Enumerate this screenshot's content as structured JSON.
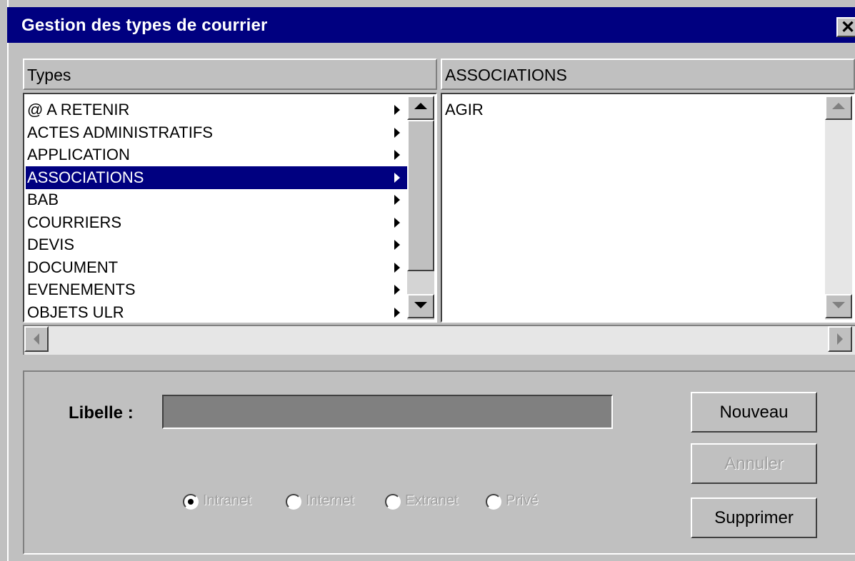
{
  "window": {
    "title": "Gestion des types de courrier",
    "close_glyph": "✕"
  },
  "types": {
    "header": "Types",
    "items": [
      {
        "label": "@ A RETENIR",
        "selected": false
      },
      {
        "label": "ACTES ADMINISTRATIFS",
        "selected": false
      },
      {
        "label": "APPLICATION",
        "selected": false
      },
      {
        "label": "ASSOCIATIONS",
        "selected": true
      },
      {
        "label": "BAB",
        "selected": false
      },
      {
        "label": "COURRIERS",
        "selected": false
      },
      {
        "label": "DEVIS",
        "selected": false
      },
      {
        "label": "DOCUMENT",
        "selected": false
      },
      {
        "label": "EVENEMENTS",
        "selected": false
      },
      {
        "label": "OBJETS ULR",
        "selected": false
      }
    ]
  },
  "associations": {
    "header": "ASSOCIATIONS",
    "items": [
      "AGIR"
    ]
  },
  "form": {
    "libelle_label": "Libelle :",
    "libelle_value": "",
    "radios": [
      {
        "label": "Intranet",
        "checked": true
      },
      {
        "label": "Internet",
        "checked": false
      },
      {
        "label": "Extranet",
        "checked": false
      },
      {
        "label": "Privé",
        "checked": false
      }
    ]
  },
  "buttons": {
    "nouveau": "Nouveau",
    "annuler": "Annuler",
    "supprimer": "Supprimer"
  },
  "icons": {
    "close": "close-icon",
    "submenu": "submenu-arrow-icon",
    "scroll_up": "scroll-up-icon",
    "scroll_down": "scroll-down-icon",
    "scroll_left": "scroll-left-icon",
    "scroll_right": "scroll-right-icon"
  },
  "colors": {
    "title_bar": "#000080",
    "selection": "#000080",
    "face": "#c0c0c0",
    "field": "#808080"
  }
}
